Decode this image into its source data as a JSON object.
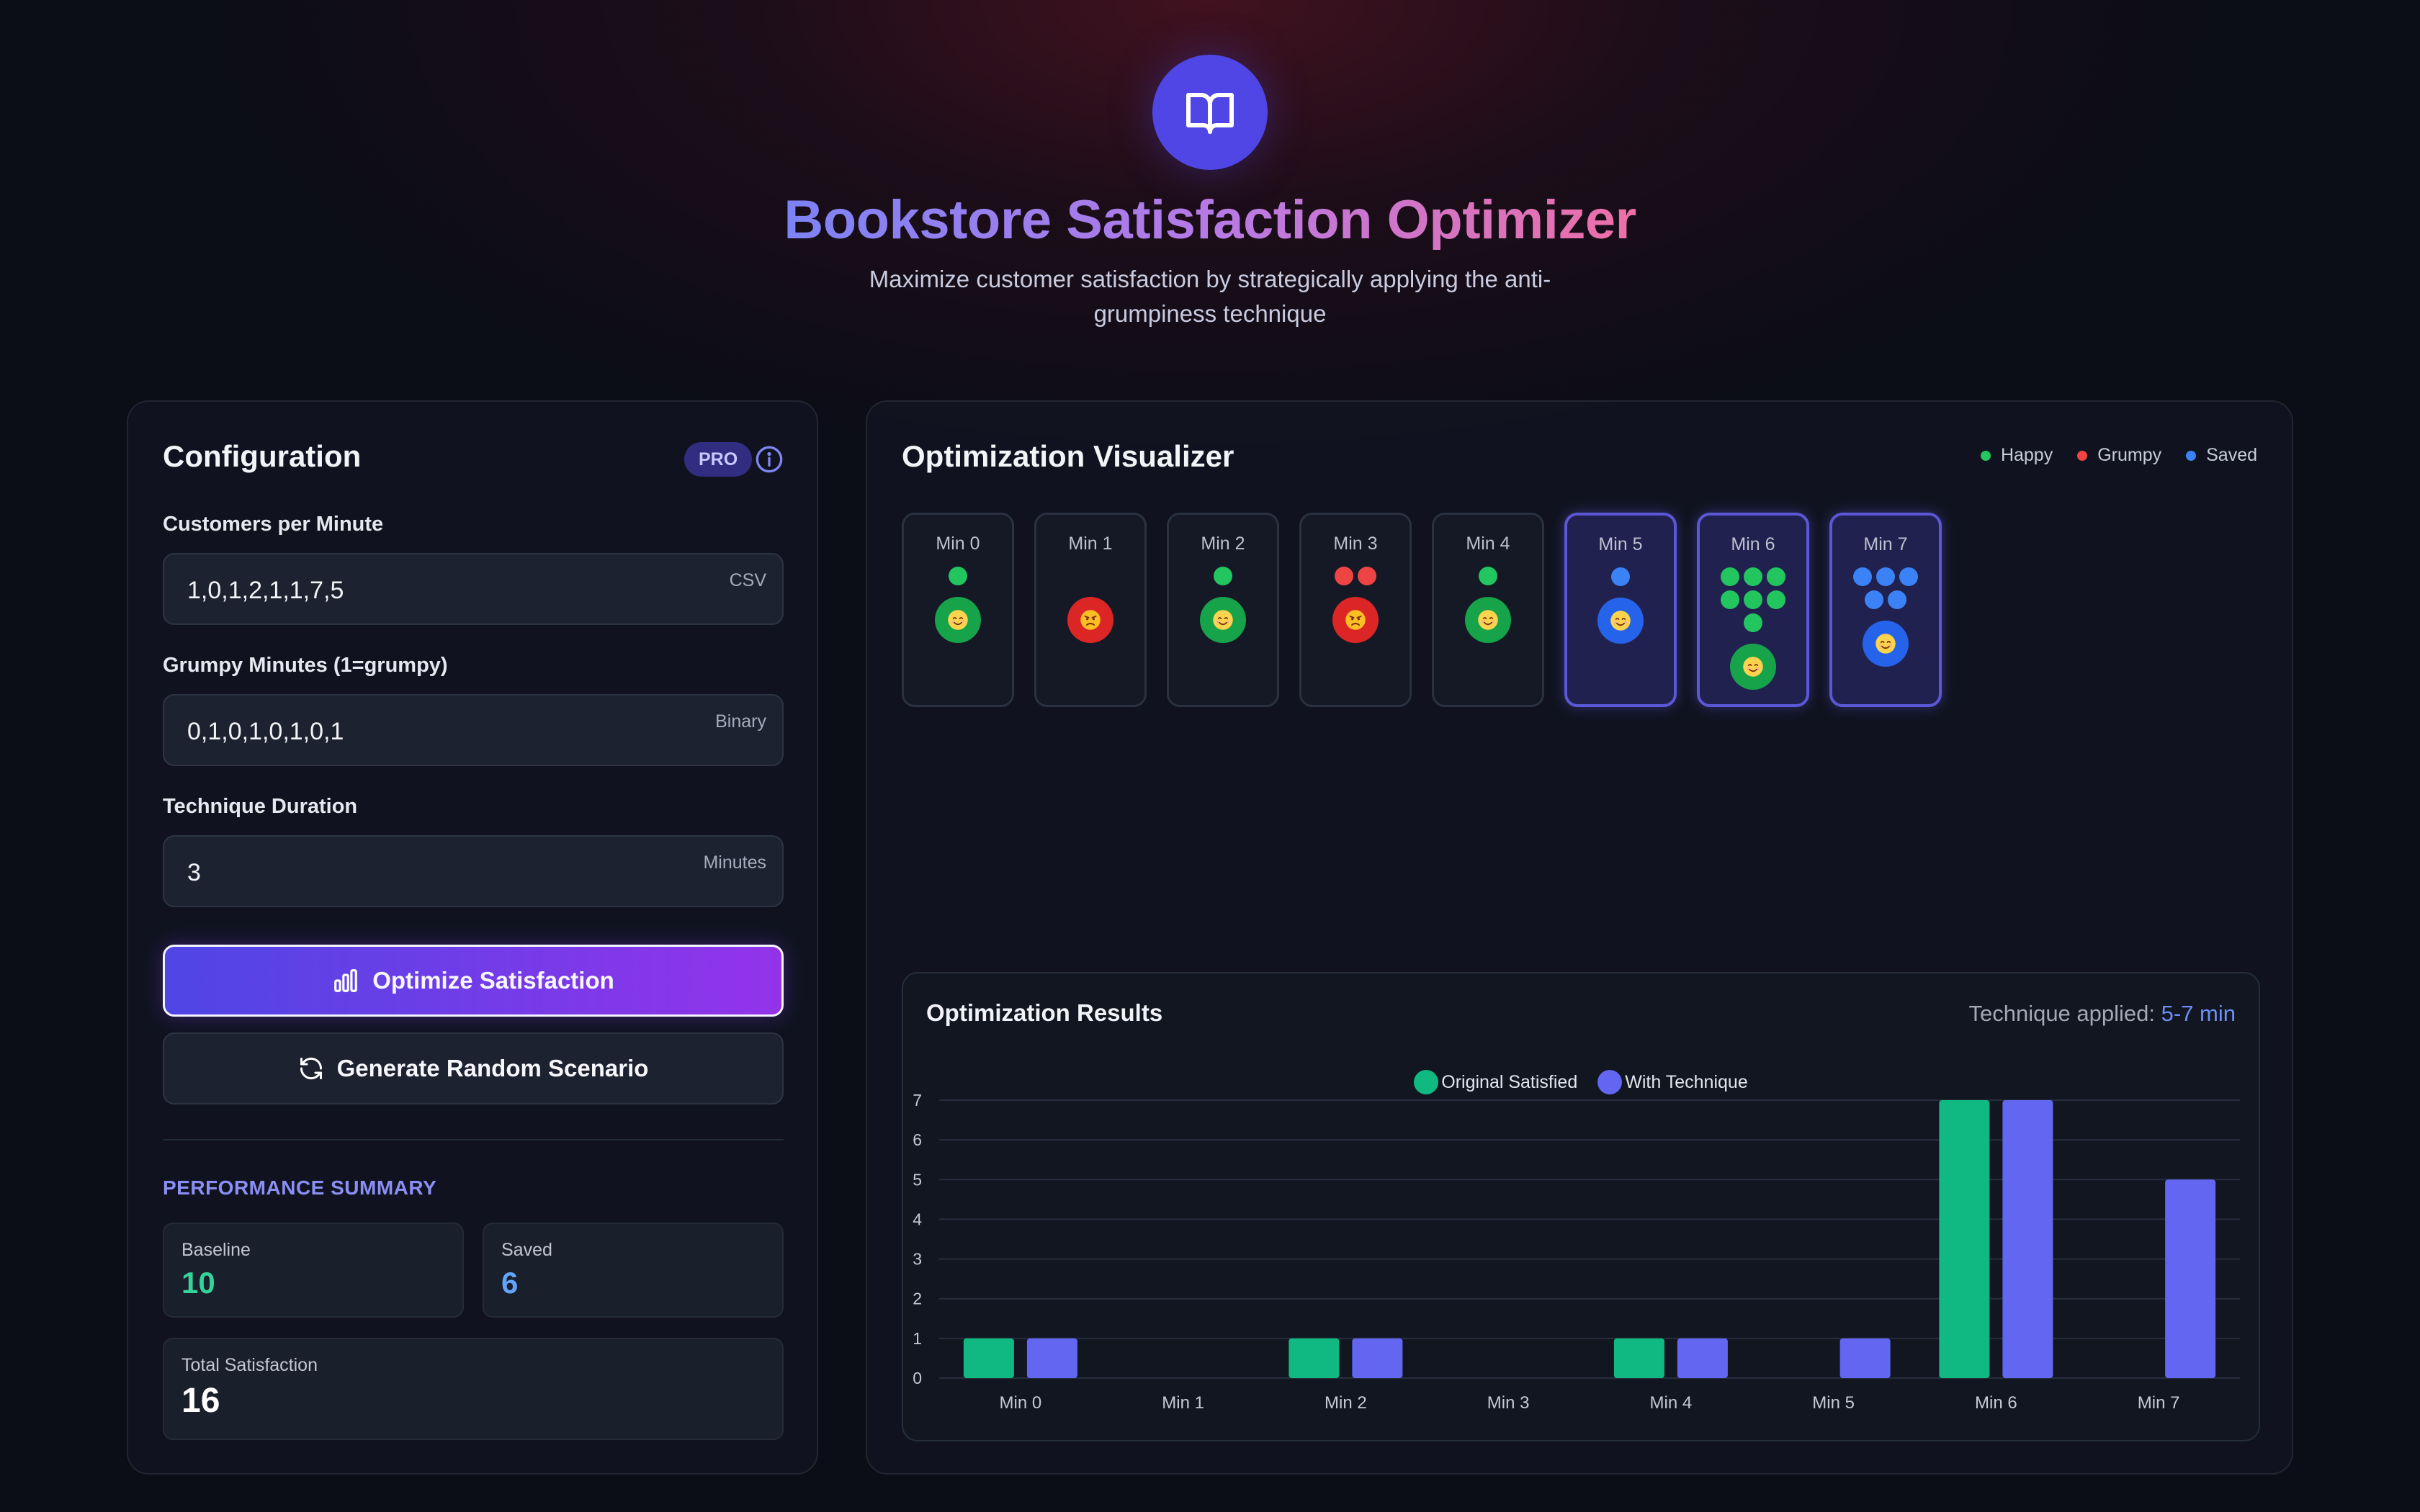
{
  "header": {
    "logo_icon": "open-book-icon",
    "title": "Bookstore Satisfaction Optimizer",
    "subtitle": "Maximize customer satisfaction by strategically applying the anti-grumpiness technique"
  },
  "config": {
    "title": "Configuration",
    "badge": "PRO",
    "info_icon": "info-icon",
    "fields": {
      "customers": {
        "label": "Customers per Minute",
        "value": "1,0,1,2,1,1,7,5",
        "hint": "CSV"
      },
      "grumpy": {
        "label": "Grumpy Minutes (1=grumpy)",
        "value": "0,1,0,1,0,1,0,1",
        "hint": "Binary"
      },
      "duration": {
        "label": "Technique Duration",
        "value": "3",
        "hint": "Minutes"
      }
    },
    "optimize_label": "Optimize Satisfaction",
    "optimize_icon": "bar-chart-icon",
    "random_label": "Generate Random Scenario",
    "random_icon": "refresh-icon",
    "summary": {
      "title": "PERFORMANCE SUMMARY",
      "baseline_label": "Baseline",
      "baseline_value": "10",
      "saved_label": "Saved",
      "saved_value": "6",
      "total_label": "Total Satisfaction",
      "total_value": "16"
    }
  },
  "visualizer": {
    "title": "Optimization Visualizer",
    "legend": [
      {
        "label": "Happy",
        "color": "#22c55e"
      },
      {
        "label": "Grumpy",
        "color": "#ef4444"
      },
      {
        "label": "Saved",
        "color": "#3b82f6"
      }
    ],
    "minutes": [
      {
        "label": "Min 0",
        "customers": 1,
        "state": "happy"
      },
      {
        "label": "Min 1",
        "customers": 0,
        "state": "grumpy"
      },
      {
        "label": "Min 2",
        "customers": 1,
        "state": "happy"
      },
      {
        "label": "Min 3",
        "customers": 2,
        "state": "grumpy"
      },
      {
        "label": "Min 4",
        "customers": 1,
        "state": "happy"
      },
      {
        "label": "Min 5",
        "customers": 1,
        "state": "saved",
        "applied": true
      },
      {
        "label": "Min 6",
        "customers": 7,
        "state": "happy",
        "applied": true
      },
      {
        "label": "Min 7",
        "customers": 5,
        "state": "saved",
        "applied": true
      }
    ],
    "colors": {
      "happy": "#22c55e",
      "grumpy": "#ef4444",
      "saved": "#3b82f6",
      "happy_face": "#16a34a",
      "grumpy_face": "#dc2626",
      "saved_face": "#2563eb"
    }
  },
  "results": {
    "title": "Optimization Results",
    "applied_prefix": "Technique applied: ",
    "applied_range": "5-7 min"
  },
  "chart_data": {
    "type": "bar",
    "categories": [
      "Min 0",
      "Min 1",
      "Min 2",
      "Min 3",
      "Min 4",
      "Min 5",
      "Min 6",
      "Min 7"
    ],
    "series": [
      {
        "name": "Original Satisfied",
        "color": "#10b981",
        "values": [
          1,
          0,
          1,
          0,
          1,
          0,
          7,
          0
        ]
      },
      {
        "name": "With Technique",
        "color": "#6366f1",
        "values": [
          1,
          0,
          1,
          0,
          1,
          1,
          7,
          5
        ]
      }
    ],
    "yticks": [
      "0",
      "1",
      "2",
      "3",
      "4",
      "5",
      "6",
      "7"
    ],
    "ylim": [
      0,
      7
    ],
    "grid": true,
    "legend": "top-center"
  }
}
